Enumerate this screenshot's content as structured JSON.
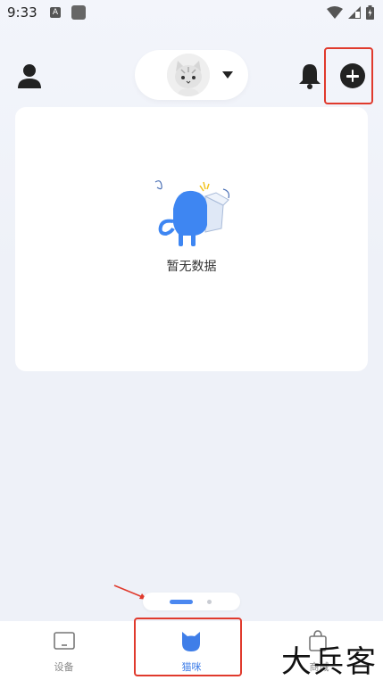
{
  "status_bar": {
    "time": "9:33",
    "notification_badge": "A"
  },
  "header": {
    "profile_icon": "person-icon",
    "notification_icon": "bell-icon",
    "add_icon": "plus-circle-icon",
    "cat_selector_icon": "cat-avatar"
  },
  "empty_state": {
    "message": "暂无数据"
  },
  "pager": {
    "active_index": 0,
    "page_count": 2
  },
  "bottom_nav": {
    "items": [
      {
        "label": "设备",
        "icon": "tablet-icon",
        "active": false
      },
      {
        "label": "猫咪",
        "icon": "cat-head-icon",
        "active": true
      },
      {
        "label": "商城",
        "icon": "shopping-bag-icon",
        "active": false
      }
    ]
  },
  "watermark": "大兵客",
  "colors": {
    "accent": "#3f7ee8",
    "annotation": "#e03a2d",
    "background": "#eef1f8"
  }
}
